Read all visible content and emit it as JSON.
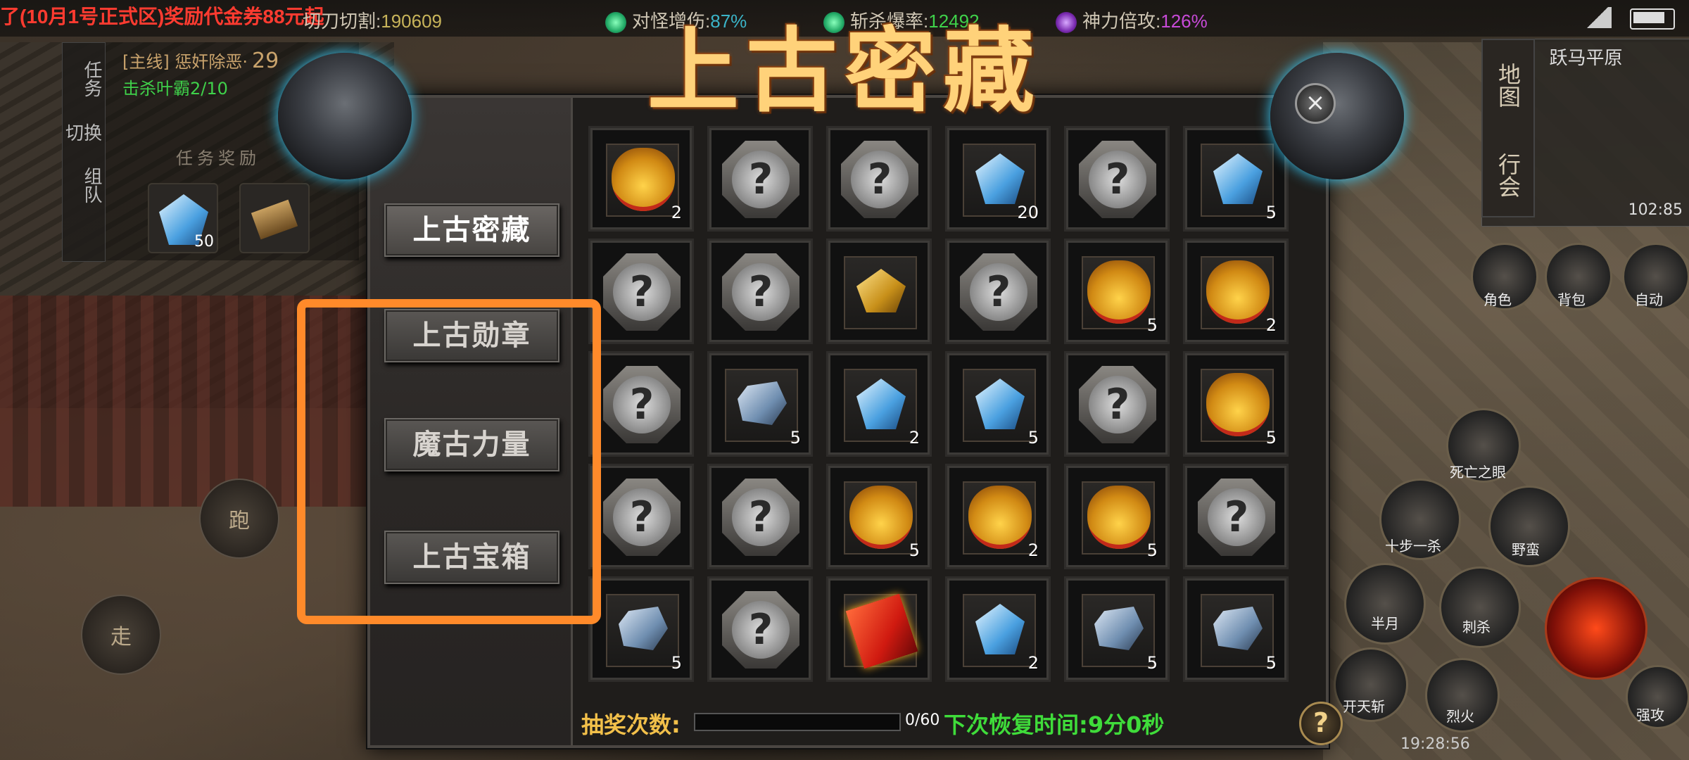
{
  "topbar": {
    "announce": "了(10月1号正式区)奖励代金券88元起",
    "stats": [
      {
        "label": "切刀切割:",
        "value": "190609",
        "color": "#c8b45a"
      },
      {
        "label": "对怪增伤:",
        "value": "87%",
        "color": "#3bb4c8"
      },
      {
        "label": "斩杀爆率:",
        "value": "12492",
        "color": "#3fd14a"
      },
      {
        "label": "神力倍攻:",
        "value": "126%",
        "color": "#c84ad8"
      }
    ]
  },
  "quest": {
    "tabs": [
      "任务",
      "切换",
      "组队"
    ],
    "title": "[主线] 惩奸除恶·",
    "level": "29",
    "objective": "击杀叶霸2/10",
    "reward_title": "任务奖励",
    "rewards": [
      {
        "icon": "crystal-icon",
        "count": "50"
      },
      {
        "icon": "scroll-icon",
        "count": ""
      }
    ]
  },
  "controls": {
    "run": "跑",
    "walk": "走"
  },
  "minimap": {
    "region": "跃马平原",
    "coords": "102:85",
    "tabs": [
      "地图",
      "行会"
    ]
  },
  "hud": {
    "clock": "19:28:56",
    "skills": [
      {
        "label": "角色"
      },
      {
        "label": "背包"
      },
      {
        "label": "自动"
      },
      {
        "label": "死亡之眼"
      },
      {
        "label": "十步一杀"
      },
      {
        "label": "野蛮"
      },
      {
        "label": "半月"
      },
      {
        "label": "刺杀"
      },
      {
        "label": "开天斩"
      },
      {
        "label": "烈火"
      },
      {
        "label": "强攻"
      }
    ]
  },
  "dialog": {
    "title": "上古密藏",
    "close": "×",
    "tabs": [
      "上古密藏",
      "上古勋章",
      "魔古力量",
      "上古宝箱"
    ],
    "active_tab": 0,
    "highlight_color": "#ff8a2a",
    "grid": [
      [
        {
          "type": "bag",
          "count": "2"
        },
        {
          "type": "mystery"
        },
        {
          "type": "mystery"
        },
        {
          "type": "crystal",
          "count": "20"
        },
        {
          "type": "mystery"
        },
        {
          "type": "crystal",
          "count": "5"
        }
      ],
      [
        {
          "type": "mystery"
        },
        {
          "type": "mystery"
        },
        {
          "type": "gold",
          "count": ""
        },
        {
          "type": "mystery"
        },
        {
          "type": "bag",
          "count": "5"
        },
        {
          "type": "bag",
          "count": "2"
        }
      ],
      [
        {
          "type": "mystery"
        },
        {
          "type": "shard",
          "count": "5"
        },
        {
          "type": "crystal",
          "count": "2"
        },
        {
          "type": "crystal",
          "count": "5"
        },
        {
          "type": "mystery"
        },
        {
          "type": "bag",
          "count": "5"
        }
      ],
      [
        {
          "type": "mystery"
        },
        {
          "type": "mystery"
        },
        {
          "type": "bag",
          "count": "5"
        },
        {
          "type": "bag",
          "count": "2"
        },
        {
          "type": "bag",
          "count": "5"
        },
        {
          "type": "mystery"
        }
      ],
      [
        {
          "type": "shard",
          "count": "5"
        },
        {
          "type": "mystery"
        },
        {
          "type": "book",
          "count": ""
        },
        {
          "type": "crystal",
          "count": "2"
        },
        {
          "type": "shard",
          "count": "5"
        },
        {
          "type": "shard",
          "count": "5"
        }
      ]
    ],
    "draw_label": "抽奖次数:",
    "draw_count": "0/60",
    "draw_progress": 0,
    "recover_label": "下次恢复时间:",
    "recover_value": "9分0秒",
    "help": "?"
  }
}
